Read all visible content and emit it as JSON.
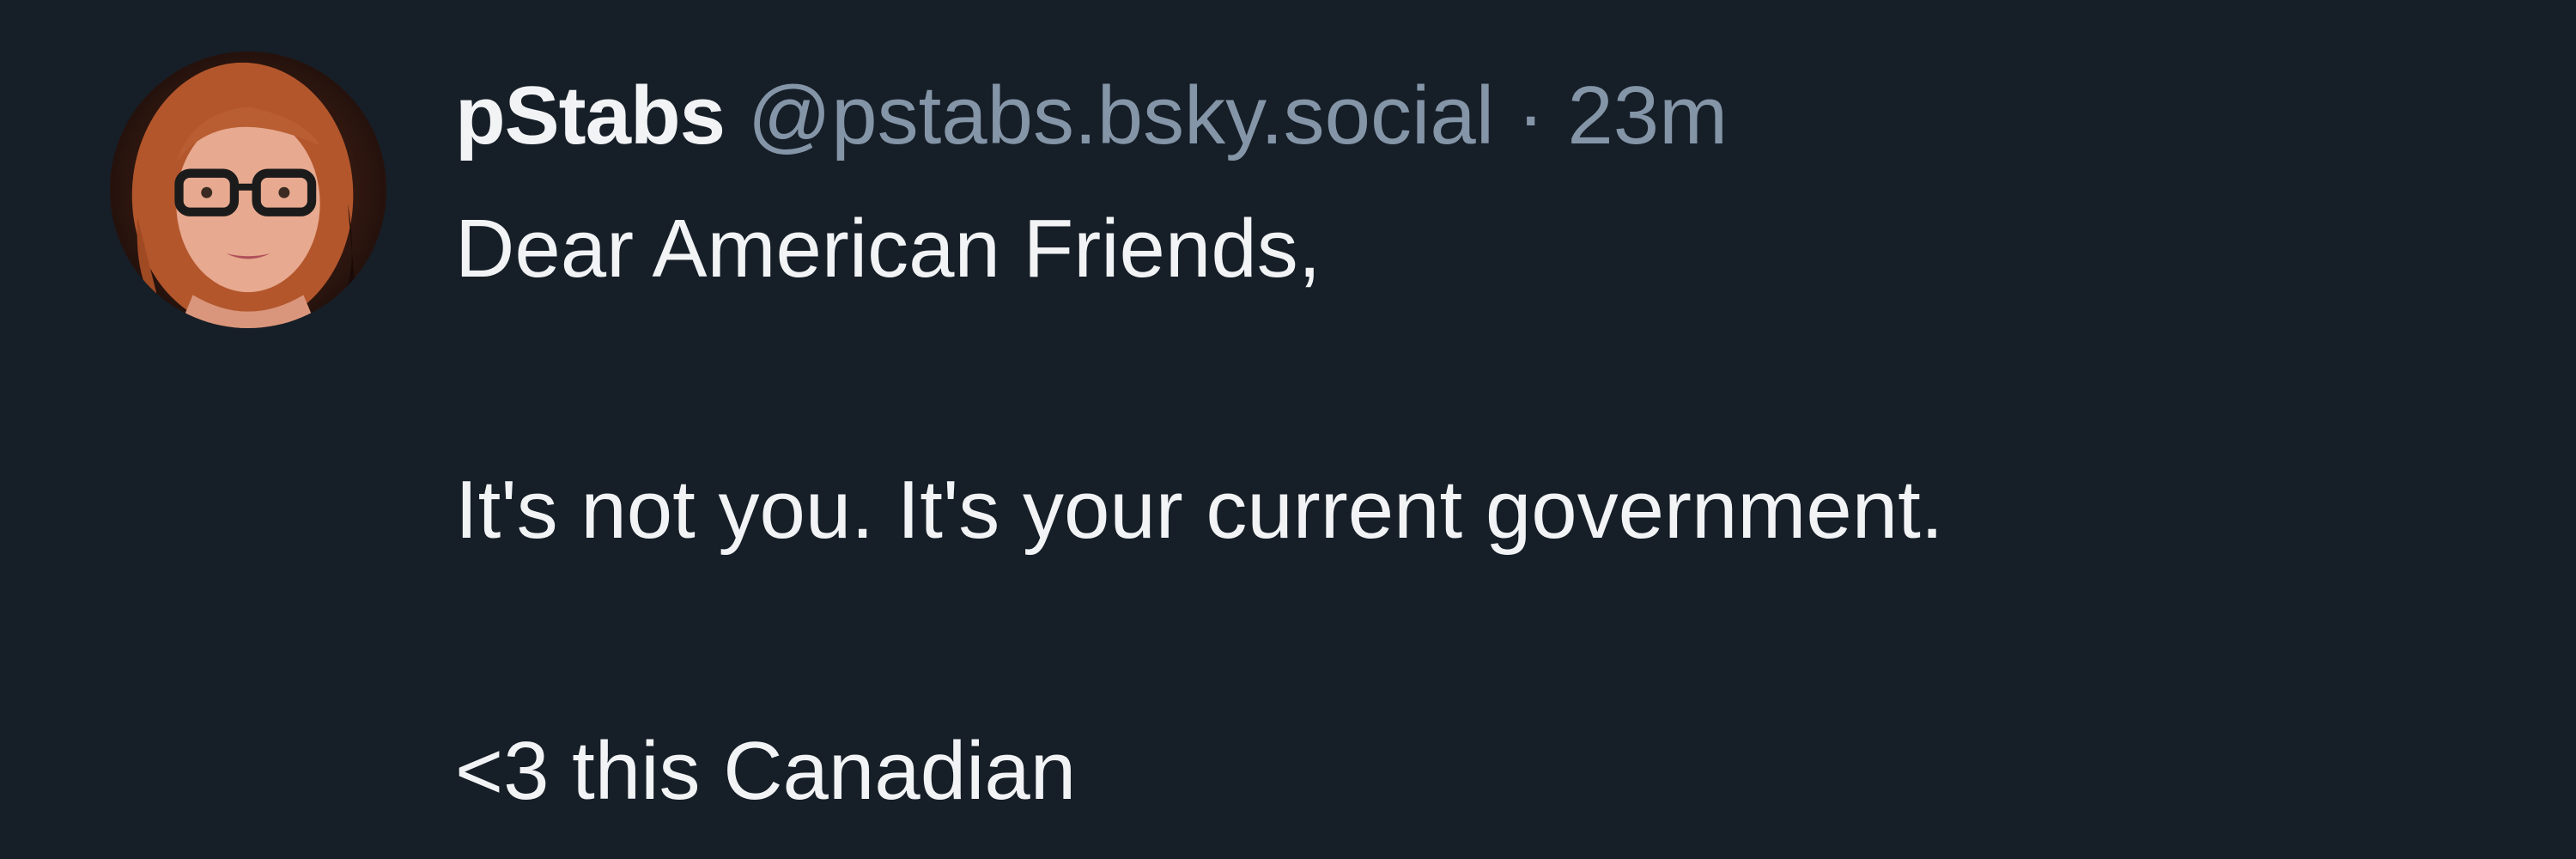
{
  "post": {
    "author": {
      "display_name": "pStabs",
      "handle": "@pstabs.bsky.social",
      "avatar_icon": "avatar-photo"
    },
    "separator": "·",
    "timestamp": "23m",
    "text_lines": [
      "Dear American Friends,",
      "",
      "It's not you. It's your current government.",
      "",
      "<3 this Canadian"
    ]
  },
  "colors": {
    "background": "#161e27",
    "primary_text": "#f1f3f5",
    "secondary_text": "#8495a8"
  }
}
